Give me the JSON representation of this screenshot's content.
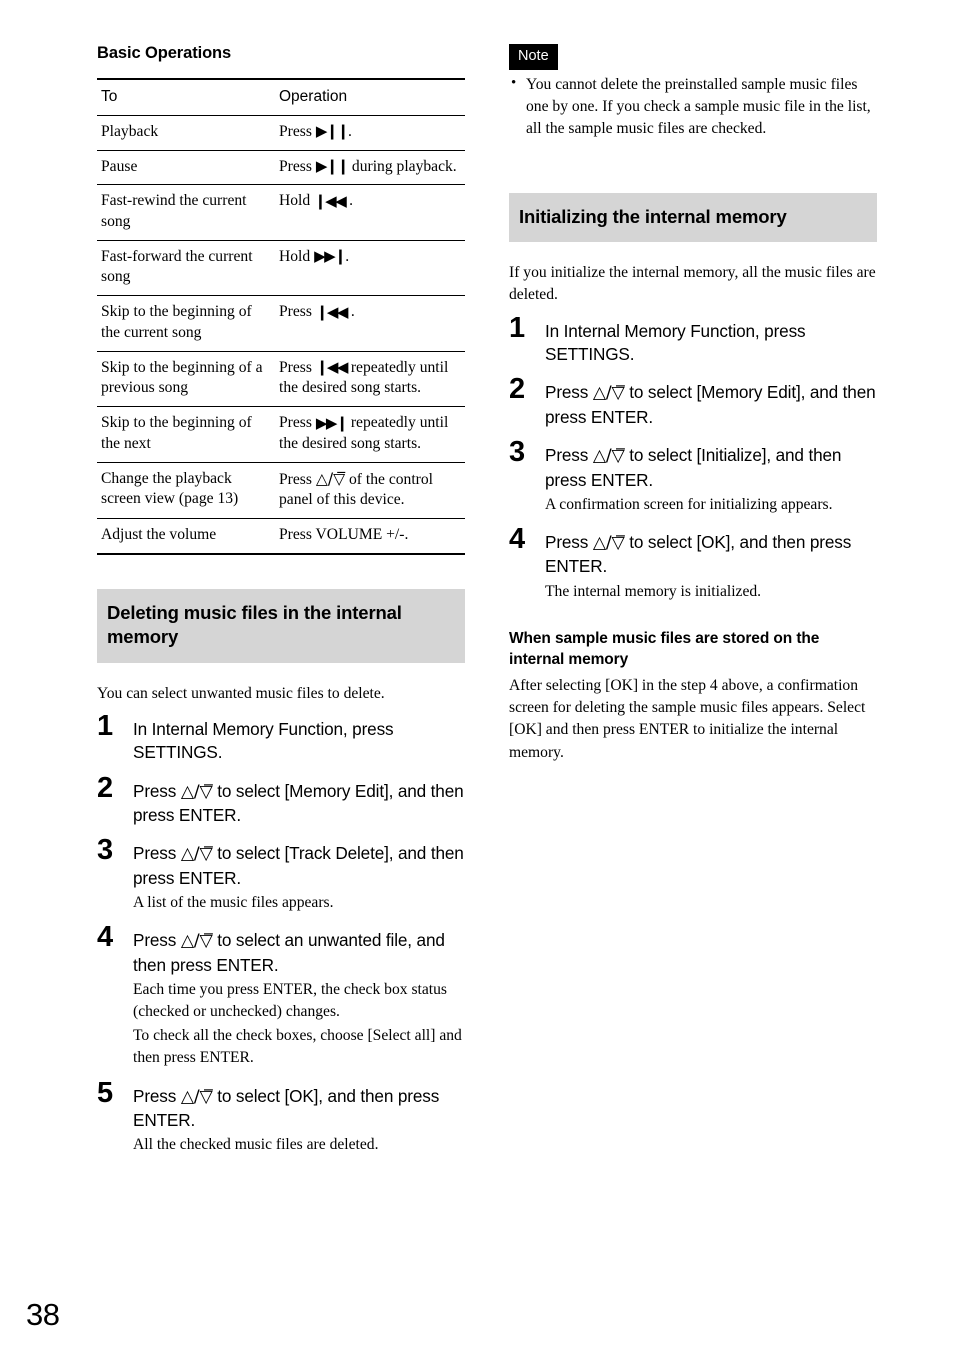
{
  "page": {
    "number": "38"
  },
  "left_column": {
    "heading": "Basic Operations",
    "table": {
      "columns": [
        "To",
        "Operation"
      ],
      "rows": [
        {
          "to": "Playback",
          "op_pre": "Press ",
          "op_glyph": "play-pause",
          "op_post": "."
        },
        {
          "to": "Pause",
          "op_pre": "Press ",
          "op_glyph": "play-pause",
          "op_post": " during playback."
        },
        {
          "to": "Fast-rewind the current song",
          "op_pre": "Hold ",
          "op_glyph": "rewind",
          "op_post": " ."
        },
        {
          "to": "Fast-forward the current song",
          "op_pre": "Hold ",
          "op_glyph": "forward",
          "op_post": "."
        },
        {
          "to": "Skip to the beginning of the current song",
          "op_pre": "Press ",
          "op_glyph": "rewind",
          "op_post": " ."
        },
        {
          "to": "Skip to the beginning of a previous song",
          "op_pre": "Press ",
          "op_glyph": "rewind",
          "op_post": " repeatedly until the desired song starts."
        },
        {
          "to": "Skip to the beginning of the next",
          "op_pre": "Press ",
          "op_glyph": "forward",
          "op_post": " repeatedly until the desired song starts."
        },
        {
          "to": "Change the playback screen view (page 13)",
          "op_pre": "Press ",
          "op_glyph": "up-down-triangle",
          "op_post": " of the control panel of this device."
        },
        {
          "to": "Adjust the volume",
          "op_pre": "Press VOLUME +/-.",
          "op_glyph": "",
          "op_post": ""
        }
      ]
    },
    "section": {
      "heading": "Deleting music files in the internal memory",
      "intro": "You can select unwanted music files to delete.",
      "steps": [
        {
          "num": "1",
          "main": "In Internal Memory Function, press SETTINGS.",
          "sub": ""
        },
        {
          "num": "2",
          "main_pre": "Press ",
          "main_glyph": "up-down-triangle",
          "main_post": " to select [Memory Edit], and then press ENTER.",
          "sub": ""
        },
        {
          "num": "3",
          "main_pre": "Press ",
          "main_glyph": "up-down-triangle",
          "main_post": " to select [Track Delete], and then press ENTER.",
          "sub": "A list of the music files appears."
        },
        {
          "num": "4",
          "main_pre": "Press ",
          "main_glyph": "up-down-triangle",
          "main_post": " to select an unwanted file, and then press ENTER.",
          "sub": "Each time you press ENTER, the check box status (checked or unchecked) changes.\nTo check all the check boxes, choose [Select all] and then press ENTER."
        },
        {
          "num": "5",
          "main_pre": "Press ",
          "main_glyph": "up-down-triangle",
          "main_post": " to select [OK], and then press ENTER.",
          "sub": "All the checked music files are deleted."
        }
      ]
    }
  },
  "right_column": {
    "note": {
      "badge": "Note",
      "items": [
        "You cannot delete the preinstalled sample music files one by one. If you check a sample music file in the list, all the sample music files are checked."
      ]
    },
    "section": {
      "heading": "Initializing the internal memory",
      "intro": "If you initialize the internal memory, all the music files are deleted.",
      "steps": [
        {
          "num": "1",
          "main": "In Internal Memory Function, press SETTINGS.",
          "sub": ""
        },
        {
          "num": "2",
          "main_pre": "Press ",
          "main_glyph": "up-down-triangle",
          "main_post": " to select [Memory Edit], and then press ENTER.",
          "sub": ""
        },
        {
          "num": "3",
          "main_pre": "Press ",
          "main_glyph": "up-down-triangle",
          "main_post": " to select [Initialize], and then press ENTER.",
          "sub": "A confirmation screen for initializing appears."
        },
        {
          "num": "4",
          "main_pre": "Press ",
          "main_glyph": "up-down-triangle",
          "main_post": " to select [OK], and then press ENTER.",
          "sub": "The internal memory is initialized."
        }
      ]
    },
    "subsection": {
      "heading": "When sample music files are stored on the internal memory",
      "body": "After selecting [OK] in the step 4 above, a confirmation screen for deleting the sample music files appears. Select [OK] and then press ENTER to initialize the internal memory."
    }
  },
  "glyphs": {
    "play-pause": "▶❙❙",
    "rewind": "❙◀◀",
    "forward": "▶▶❙",
    "up-down-triangle": "△/▽̅"
  },
  "colors": {
    "heading_band": "#d5d5d5",
    "note_badge_bg": "#000000",
    "text": "#000000",
    "page_bg": "#ffffff"
  }
}
